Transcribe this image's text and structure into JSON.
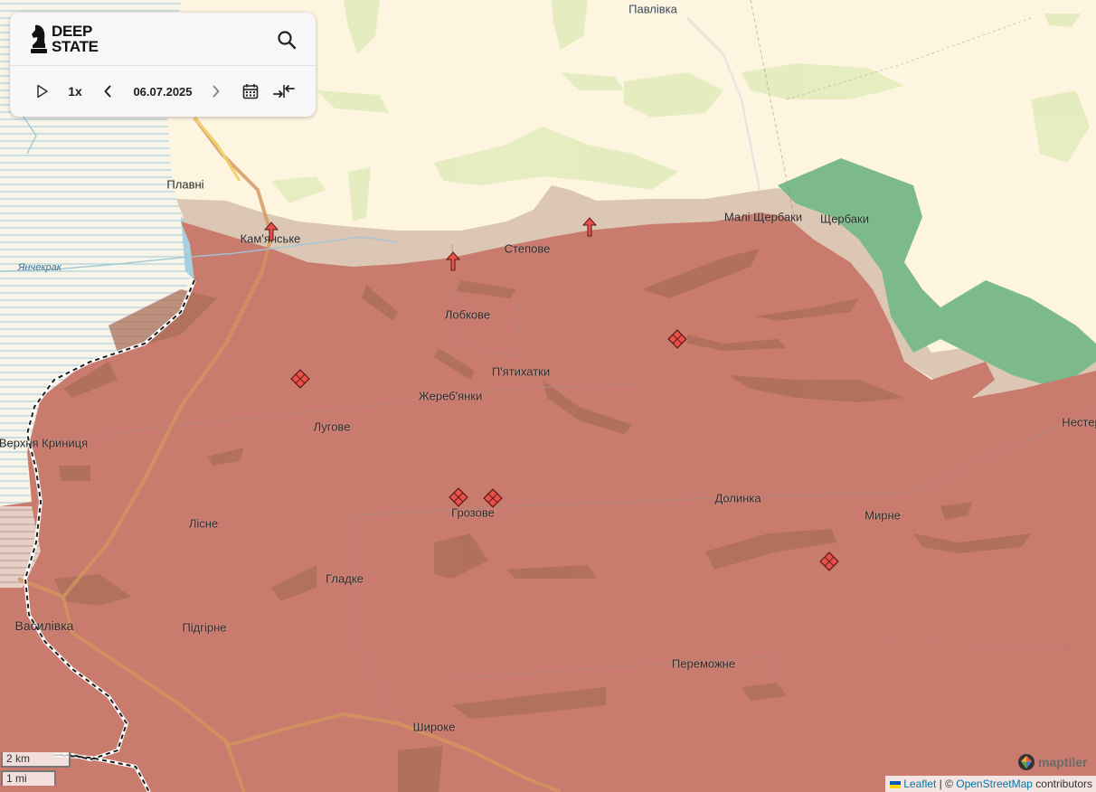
{
  "app": {
    "logo_line1": "DEEP",
    "logo_line2": "STATE"
  },
  "controls": {
    "play_icon": "play-icon",
    "speed": "1x",
    "date": "06.07.2025",
    "prev_icon": "chevron-left-icon",
    "next_icon": "chevron-right-icon",
    "calendar_icon": "calendar-icon",
    "compare_icon": "compare-arrows-icon",
    "search_icon": "search-icon"
  },
  "places": {
    "pavlivka": "Павлівка",
    "plavni": "Плавні",
    "kamianske": "Кам'янське",
    "stepove": "Степове",
    "mali_shcherbaky": "Малі Щербаки",
    "shcherbaky": "Щербаки",
    "lobkove": "Лобкове",
    "piatykhatky": "П'ятихатки",
    "zherebianky": "Жереб'янки",
    "luhove": "Лугове",
    "verkhnia_krynytsia": "Верхня Криниця",
    "nesterianka": "Нестер",
    "dolynka": "Долинка",
    "hrozove": "Грозове",
    "mirne": "Мирне",
    "lisne": "Лісне",
    "hladke": "Гладке",
    "vasylivka": "Василівка",
    "pidhirne": "Підгірне",
    "peremozhne": "Переможне",
    "shyroke": "Широке"
  },
  "rivers": {
    "yanchekrak": "Янчекрак"
  },
  "scale": {
    "km": "2 km",
    "mi": "1 mi"
  },
  "attribution": {
    "leaflet": "Leaflet",
    "separator": " | © ",
    "osm": "OpenStreetMap",
    "contributors": " contributors",
    "maptiler": "maptiler"
  },
  "colors": {
    "occupied": "#c97b6d",
    "grey_zone": "#d9c3b0",
    "liberated": "#7cba8c",
    "background": "#fdf5e0",
    "marker": "#e8504a"
  }
}
